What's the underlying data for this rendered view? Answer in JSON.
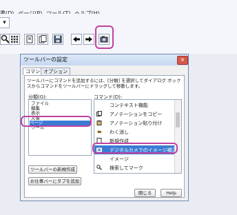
{
  "menubar": {
    "items": [
      "書(D)",
      "ページ(P)",
      "ツール(T)",
      "ヘルプ(H)"
    ]
  },
  "toolbar": {
    "dropdown_glyph": "▾",
    "icons": [
      "search-icon",
      "grid-icon",
      "page-icon",
      "pages-icon",
      "save-icon",
      "back-arrow-icon",
      "forward-arrow-icon",
      "camera-plus-icon"
    ]
  },
  "dialog": {
    "title": "ツールバーの設定",
    "close_label": "×",
    "tabs": [
      "コマンド",
      "オプション"
    ],
    "description": "ツールバーにコマンドを追加するには、[分類] を選択してダイアログ ボックスからコマンドをツールバーにドラッグして移動します。",
    "category_label": "分類(G):",
    "commands_label": "コマンド(D):",
    "categories": [
      "ファイル",
      "編集",
      "表示",
      "文書",
      "ページ",
      "ツール"
    ],
    "selected_category_index": 4,
    "commands": [
      {
        "icon": "none",
        "label": "コンテキスト機能"
      },
      {
        "icon": "copy-icon",
        "label": "アノテーションをコピー"
      },
      {
        "icon": "paste-icon",
        "label": "アノテーション貼り付け"
      },
      {
        "icon": "undo-icon",
        "label": "わく消し"
      },
      {
        "icon": "new-icon",
        "label": "新規作成"
      },
      {
        "icon": "camera-icon",
        "label": "デジタルカメラのイメージ補正"
      },
      {
        "icon": "none",
        "label": "イメージ"
      },
      {
        "icon": "search-icon",
        "label": "検索してマーク"
      },
      {
        "icon": "none",
        "label": ""
      }
    ],
    "selected_command_index": 5,
    "buttons": {
      "new_toolbar": "ツールバーの新規作成",
      "add_tab": "お仕事バーにタブを追加",
      "close": "閉じる",
      "help": "Help"
    }
  },
  "colors": {
    "highlight": "#c040a0",
    "selection": "#3b7bd4",
    "titlebar": "#c6d8f1"
  }
}
